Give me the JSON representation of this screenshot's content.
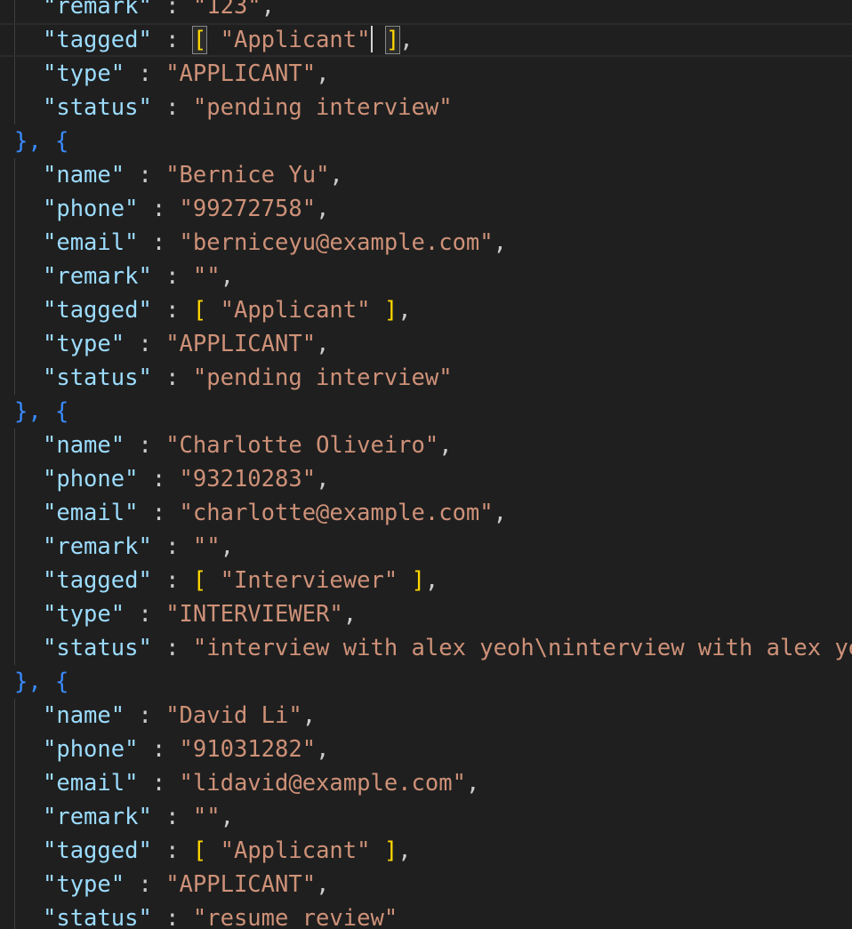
{
  "editor": {
    "theme_colors": {
      "background": "#1f1f1f",
      "key": "#9cdcfe",
      "string": "#ce9178",
      "brace": "#3a8bff",
      "bracket": "#ffd700"
    },
    "top_partial": {
      "key": "\"remark\"",
      "value": "\"123\""
    },
    "records": [
      {
        "tagged": "\"Applicant\"",
        "type": "\"APPLICANT\"",
        "status": "\"pending interview\""
      },
      {
        "name": "\"Bernice Yu\"",
        "phone": "\"99272758\"",
        "email": "\"berniceyu@example.com\"",
        "remark": "\"\"",
        "tagged": "\"Applicant\"",
        "type": "\"APPLICANT\"",
        "status": "\"pending interview\""
      },
      {
        "name": "\"Charlotte Oliveiro\"",
        "phone": "\"93210283\"",
        "email": "\"charlotte@example.com\"",
        "remark": "\"\"",
        "tagged": "\"Interviewer\"",
        "type": "\"INTERVIEWER\"",
        "status": "\"interview with alex yeoh\\ninterview with alex ye"
      },
      {
        "name": "\"David Li\"",
        "phone": "\"91031282\"",
        "email": "\"lidavid@example.com\"",
        "remark": "\"\"",
        "tagged": "\"Applicant\"",
        "type": "\"APPLICANT\"",
        "status": "\"resume review\""
      }
    ],
    "keys": {
      "name": "\"name\"",
      "phone": "\"phone\"",
      "email": "\"email\"",
      "remark": "\"remark\"",
      "tagged": "\"tagged\"",
      "type": "\"type\"",
      "status": "\"status\""
    },
    "separator": "}, {"
  }
}
